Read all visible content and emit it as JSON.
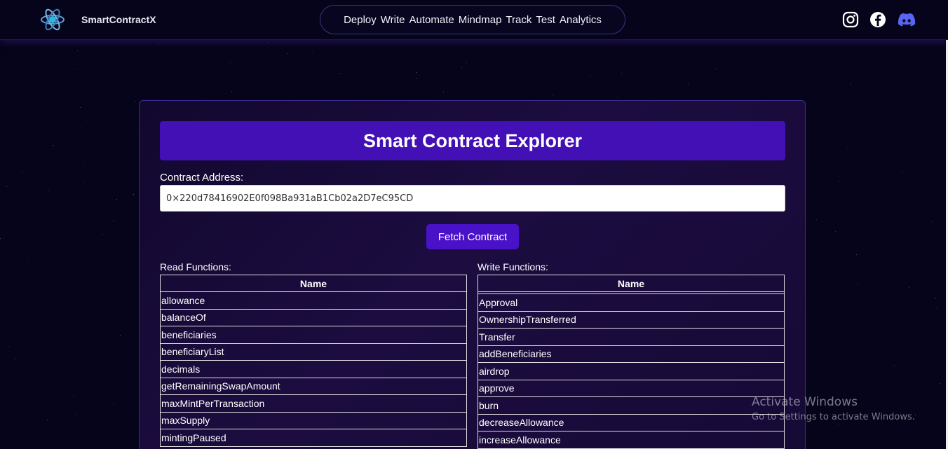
{
  "navbar": {
    "brand": "SmartContractX",
    "links": [
      "Deploy",
      "Write",
      "Automate",
      "Mindmap",
      "Track",
      "Test",
      "Analytics"
    ],
    "social": [
      "instagram-icon",
      "facebook-icon",
      "discord-icon"
    ]
  },
  "explorer": {
    "title": "Smart Contract Explorer",
    "address_label": "Contract Address:",
    "address_value": "0×220d78416902E0f098Ba931aB1Cb02a2D7eC95CD",
    "fetch_label": "Fetch Contract",
    "read": {
      "label": "Read Functions:",
      "header": "Name",
      "rows": [
        "allowance",
        "balanceOf",
        "beneficiaries",
        "beneficiaryList",
        "decimals",
        "getRemainingSwapAmount",
        "maxMintPerTransaction",
        "maxSupply",
        "mintingPaused"
      ]
    },
    "write": {
      "label": "Write Functions:",
      "header": "Name",
      "rows": [
        "Approval",
        "OwnershipTransferred",
        "Transfer",
        "addBeneficiaries",
        "airdrop",
        "approve",
        "burn",
        "decreaseAllowance",
        "increaseAllowance"
      ]
    }
  },
  "watermark": {
    "title": "Activate Windows",
    "subtitle": "Go to Settings to activate Windows."
  },
  "colors": {
    "accent": "#4210b4",
    "background": "#06041a",
    "nav_border": "#3a3480"
  }
}
